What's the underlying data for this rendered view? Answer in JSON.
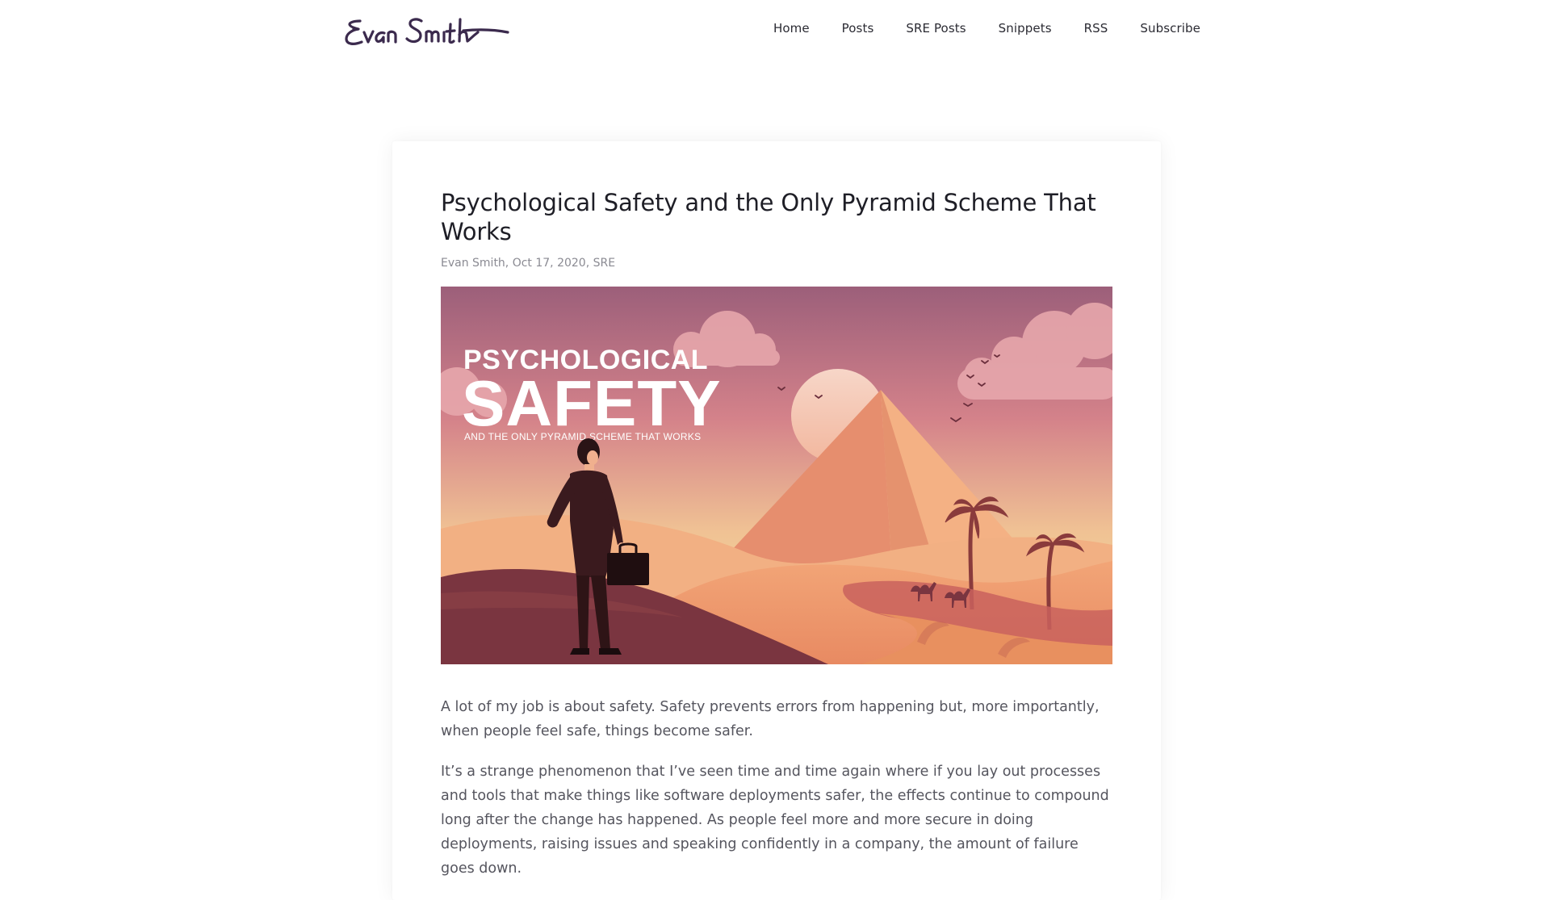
{
  "header": {
    "logo_text": "Evan Smith",
    "nav": [
      "Home",
      "Posts",
      "SRE Posts",
      "Snippets",
      "RSS",
      "Subscribe"
    ]
  },
  "post": {
    "title": "Psychological Safety and the Only Pyramid Scheme That Works",
    "meta": "Evan Smith, Oct 17, 2020, SRE",
    "hero": {
      "line1": "PSYCHOLOGICAL",
      "line2": "SAFETY",
      "line3": "AND THE ONLY PYRAMID SCHEME THAT WORKS"
    },
    "paragraphs": [
      "A lot of my job is about safety. Safety prevents errors from happening but, more importantly, when people feel safe, things become safer.",
      "It’s a strange phenomenon that I’ve seen time and time again where if you lay out processes and tools that make things like software deployments safer, the effects continue to compound long after the change has happened. As people feel more and more secure in doing deployments, raising issues and speaking confidently in a company, the amount of failure goes down."
    ]
  },
  "colors": {
    "logo": "#3b2a4d",
    "nav_text": "#2b2b33",
    "title": "#1e1e26",
    "meta": "#8a8a92",
    "body_text": "#55555e",
    "sky_top": "#9c5f7a",
    "sky_bottom": "#f2e6a0",
    "pyramid_light": "#f2a87a",
    "pyramid_dark": "#d9785c",
    "dune_dark": "#7a3540"
  }
}
